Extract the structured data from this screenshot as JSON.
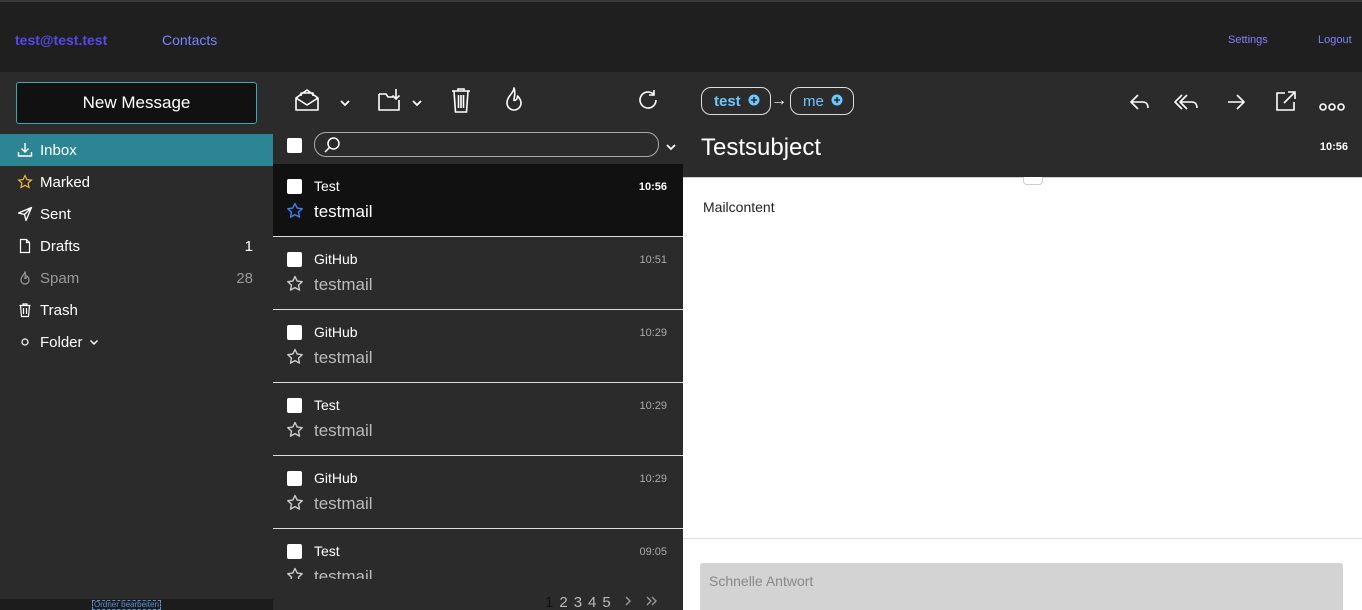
{
  "topbar": {
    "account": "test@test.test",
    "contacts": "Contacts",
    "settings": "Settings",
    "logout": "Logout"
  },
  "sidebar": {
    "new_message": "New Message",
    "items": [
      {
        "label": "Inbox",
        "count": "",
        "icon": "inbox-download-icon"
      },
      {
        "label": "Marked",
        "count": "",
        "icon": "star-icon"
      },
      {
        "label": "Sent",
        "count": "",
        "icon": "paper-plane-icon"
      },
      {
        "label": "Drafts",
        "count": "1",
        "icon": "document-icon"
      },
      {
        "label": "Spam",
        "count": "28",
        "icon": "flame-icon"
      },
      {
        "label": "Trash",
        "count": "",
        "icon": "trash-icon"
      },
      {
        "label": "Folder",
        "count": "",
        "icon": "circle-icon"
      }
    ],
    "bottom_link": "Ordner bearbeiten"
  },
  "list": {
    "search_placeholder": "",
    "mails": [
      {
        "from": "Test",
        "time": "10:56",
        "subject": "testmail",
        "selected": true
      },
      {
        "from": "GitHub",
        "time": "10:51",
        "subject": "testmail",
        "selected": false
      },
      {
        "from": "GitHub",
        "time": "10:29",
        "subject": "testmail",
        "selected": false
      },
      {
        "from": "Test",
        "time": "10:29",
        "subject": "testmail",
        "selected": false
      },
      {
        "from": "GitHub",
        "time": "10:29",
        "subject": "testmail",
        "selected": false
      },
      {
        "from": "Test",
        "time": "09:05",
        "subject": "testmail",
        "selected": false
      }
    ],
    "pages": [
      "1",
      "2",
      "3",
      "4",
      "5"
    ],
    "current_page": "1"
  },
  "reader": {
    "from": "test",
    "arrow": "→",
    "to": "me",
    "subject": "Testsubject",
    "time": "10:56",
    "content": "Mailcontent",
    "quick_reply_placeholder": "Schnelle Antwort"
  },
  "colors": {
    "accent": "#2d8594",
    "link": "#7a83ff",
    "account": "#5549e8",
    "pill_text": "#6ec6ff"
  }
}
